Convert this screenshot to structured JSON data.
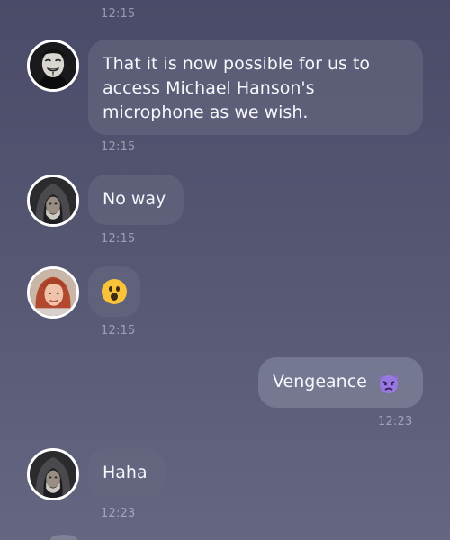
{
  "messages": [
    {
      "time": "12:15"
    },
    {
      "sender_avatar": "masked-person-avatar",
      "text": "That it is now possible for us to access Michael Hanson's microphone as we wish.",
      "time": "12:15"
    },
    {
      "sender_avatar": "hooded-man-avatar",
      "text": "No way",
      "time": "12:15"
    },
    {
      "sender_avatar": "red-haired-woman-avatar",
      "emoji": "surprised-face-icon",
      "time": "12:15"
    },
    {
      "outgoing": true,
      "text": "Vengeance",
      "emoji": "devil-face-icon",
      "time": "12:23"
    },
    {
      "sender_avatar": "hooded-man-avatar",
      "text": "Haha",
      "time": "12:23"
    }
  ],
  "colors": {
    "background_top": "#4a4b68",
    "background_bottom": "#656681",
    "bubble_incoming": "#666880",
    "bubble_outgoing": "#80829b",
    "timestamp": "#d8dae8",
    "avatar_border": "#ffffff"
  }
}
